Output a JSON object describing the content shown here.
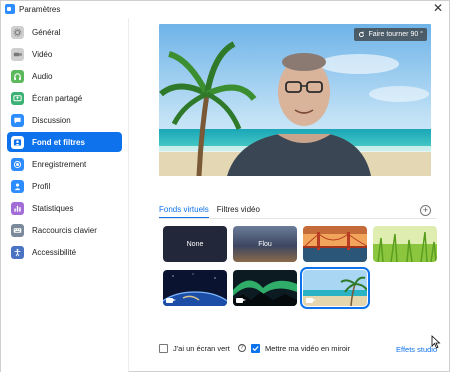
{
  "window": {
    "title": "Paramètres",
    "close_glyph": "✕"
  },
  "sidebar": {
    "items": [
      {
        "label": "Général",
        "icon": "gear-icon",
        "color": "#cfcfcf",
        "active": false
      },
      {
        "label": "Vidéo",
        "icon": "video-camera-icon",
        "color": "#cfcfcf",
        "active": false
      },
      {
        "label": "Audio",
        "icon": "headphones-icon",
        "color": "#5cb85c",
        "active": false
      },
      {
        "label": "Écran partagé",
        "icon": "screen-share-icon",
        "color": "#3bb273",
        "active": false
      },
      {
        "label": "Discussion",
        "icon": "chat-bubble-icon",
        "color": "#2d8cff",
        "active": false
      },
      {
        "label": "Fond et filtres",
        "icon": "portrait-icon",
        "color": "#ffffff",
        "active": true
      },
      {
        "label": "Enregistrement",
        "icon": "record-icon",
        "color": "#2d8cff",
        "active": false
      },
      {
        "label": "Profil",
        "icon": "person-icon",
        "color": "#2d8cff",
        "active": false
      },
      {
        "label": "Statistiques",
        "icon": "bar-chart-icon",
        "color": "#a26dd6",
        "active": false
      },
      {
        "label": "Raccourcis clavier",
        "icon": "keyboard-icon",
        "color": "#7b8a9a",
        "active": false
      },
      {
        "label": "Accessibilité",
        "icon": "accessibility-icon",
        "color": "#4a73c4",
        "active": false
      }
    ]
  },
  "preview": {
    "rotate_label": "Faire tourner 90 °"
  },
  "tabs": [
    {
      "label": "Fonds virtuels",
      "active": true
    },
    {
      "label": "Filtres vidéo",
      "active": false
    }
  ],
  "backgrounds": [
    {
      "label": "None",
      "kind": "none"
    },
    {
      "label": "Flou",
      "kind": "blur"
    },
    {
      "label": "",
      "kind": "golden-gate"
    },
    {
      "label": "",
      "kind": "grass"
    },
    {
      "label": "",
      "kind": "earth",
      "video": true
    },
    {
      "label": "",
      "kind": "aurora",
      "video": true
    },
    {
      "label": "",
      "kind": "beach",
      "video": true,
      "selected": true
    }
  ],
  "options": {
    "green_screen_label": "J'ai un écran vert",
    "mirror_label": "Mettre ma vidéo en miroir",
    "mirror_checked": true,
    "studio_effects_label": "Effets studio"
  },
  "colors": {
    "accent": "#0e72ed",
    "active_nav_bg": "#0e72ed"
  }
}
